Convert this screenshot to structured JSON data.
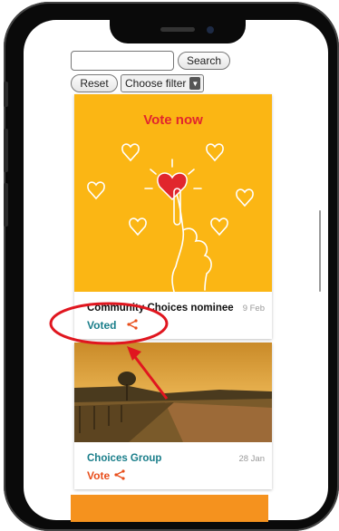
{
  "search": {
    "placeholder": "",
    "button_label": "Search"
  },
  "filter": {
    "reset_label": "Reset",
    "select_label": "Choose filter",
    "arrow": "▼"
  },
  "cards": [
    {
      "banner_title": "Vote now",
      "title": "Community Choices nominee",
      "date": "9 Feb",
      "action": "Voted",
      "share_icon": "share-icon"
    },
    {
      "title": "Choices Group",
      "date": "28 Jan",
      "action": "Vote",
      "share_icon": "share-icon"
    }
  ],
  "colors": {
    "banner": "#fbb614",
    "accent_red": "#e1262d",
    "teal": "#1a7e8a",
    "share_orange": "#e84e1b",
    "annotation_red": "#e0161f",
    "footer_bar": "#f5921e"
  }
}
